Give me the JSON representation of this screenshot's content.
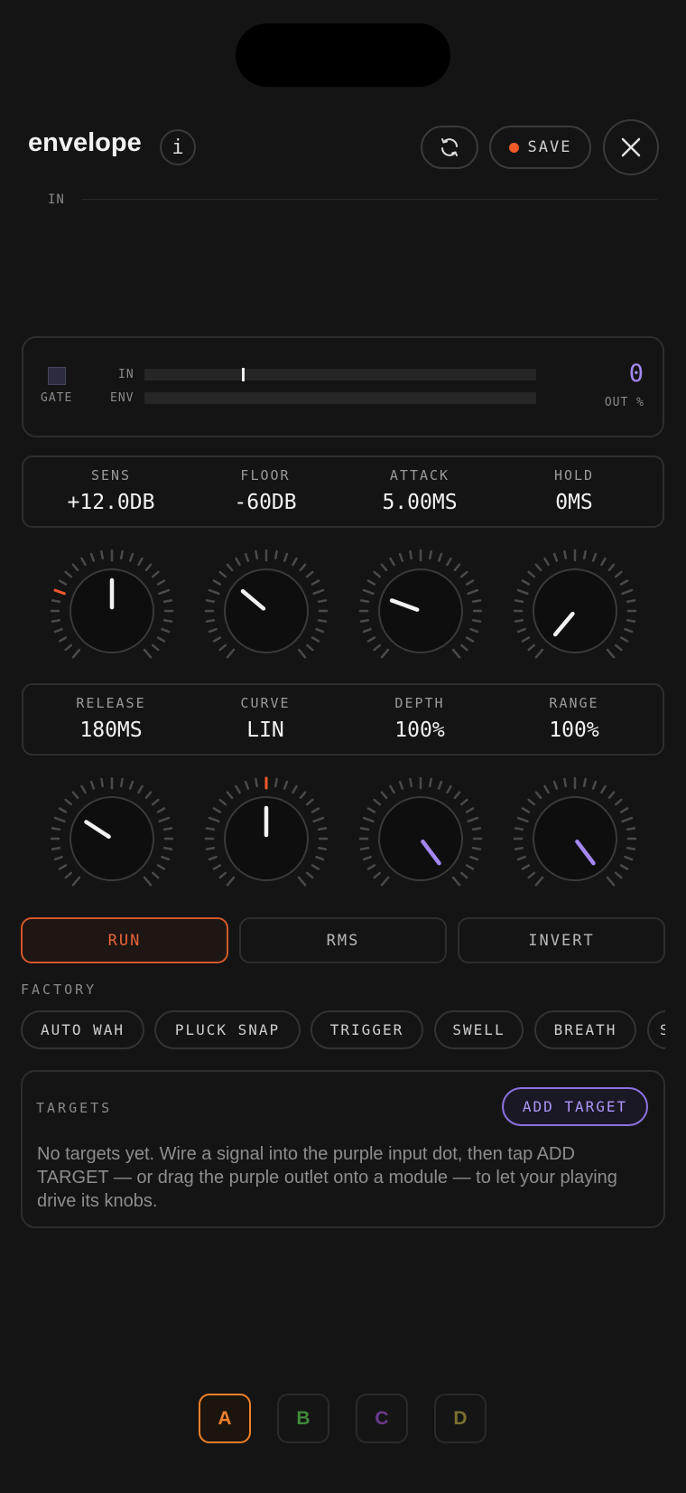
{
  "app": {
    "title": "envelope",
    "info_label": "i",
    "save_label": "SAVE",
    "colors": {
      "accent": "#f05a28",
      "purple": "#a488f0",
      "bg": "#141414"
    },
    "icons": [
      "info-icon",
      "sync-icon",
      "record-dot-icon",
      "close-icon"
    ]
  },
  "scope": {
    "label": "IN"
  },
  "meter": {
    "gate_label": "GATE",
    "in_label": "IN",
    "env_label": "ENV",
    "in_level_fraction": 0.25,
    "env_level_fraction": 0,
    "out_value": "0",
    "out_label": "OUT %"
  },
  "params_row1": [
    {
      "label": "SENS",
      "value": "+12.0DB"
    },
    {
      "label": "FLOOR",
      "value": "-60DB"
    },
    {
      "label": "ATTACK",
      "value": "5.00MS"
    },
    {
      "label": "HOLD",
      "value": "0MS"
    }
  ],
  "params_row2": [
    {
      "label": "RELEASE",
      "value": "180MS"
    },
    {
      "label": "CURVE",
      "value": "LIN"
    },
    {
      "label": "DEPTH",
      "value": "100%"
    },
    {
      "label": "RANGE",
      "value": "100%"
    }
  ],
  "knobs_row1": [
    {
      "angle_deg": 0,
      "pointer_color": "#f2f2f2",
      "highlight_tick_deg": -70
    },
    {
      "angle_deg": -50,
      "pointer_color": "#f2f2f2",
      "highlight_tick_deg": null
    },
    {
      "angle_deg": -70,
      "pointer_color": "#f2f2f2",
      "highlight_tick_deg": null
    },
    {
      "angle_deg": -140,
      "pointer_color": "#f2f2f2",
      "highlight_tick_deg": null
    }
  ],
  "knobs_row2": [
    {
      "angle_deg": -57,
      "pointer_color": "#f2f2f2",
      "highlight_tick_deg": null
    },
    {
      "angle_deg": 0,
      "pointer_color": "#f2f2f2",
      "highlight_tick_deg": 0
    },
    {
      "angle_deg": 143,
      "pointer_color": "#a488f0",
      "highlight_tick_deg": null
    },
    {
      "angle_deg": 143,
      "pointer_color": "#a488f0",
      "highlight_tick_deg": null
    }
  ],
  "toggles": [
    {
      "label": "RUN",
      "active": true
    },
    {
      "label": "RMS",
      "active": false
    },
    {
      "label": "INVERT",
      "active": false
    }
  ],
  "factory": {
    "label": "FACTORY",
    "presets": [
      "AUTO WAH",
      "PLUCK SNAP",
      "TRIGGER",
      "SWELL",
      "BREATH",
      "S"
    ]
  },
  "targets": {
    "label": "TARGETS",
    "add_label": "ADD TARGET",
    "empty_text": "No targets yet. Wire a signal into the purple input dot, then tap ADD TARGET — or drag the purple outlet onto a module — to let your playing drive its knobs."
  },
  "slots": [
    {
      "label": "A",
      "color": "#f0802a",
      "active": true
    },
    {
      "label": "B",
      "color": "#3f8a3a",
      "active": false
    },
    {
      "label": "C",
      "color": "#6a3a8e",
      "active": false
    },
    {
      "label": "D",
      "color": "#7a7030",
      "active": false
    }
  ]
}
